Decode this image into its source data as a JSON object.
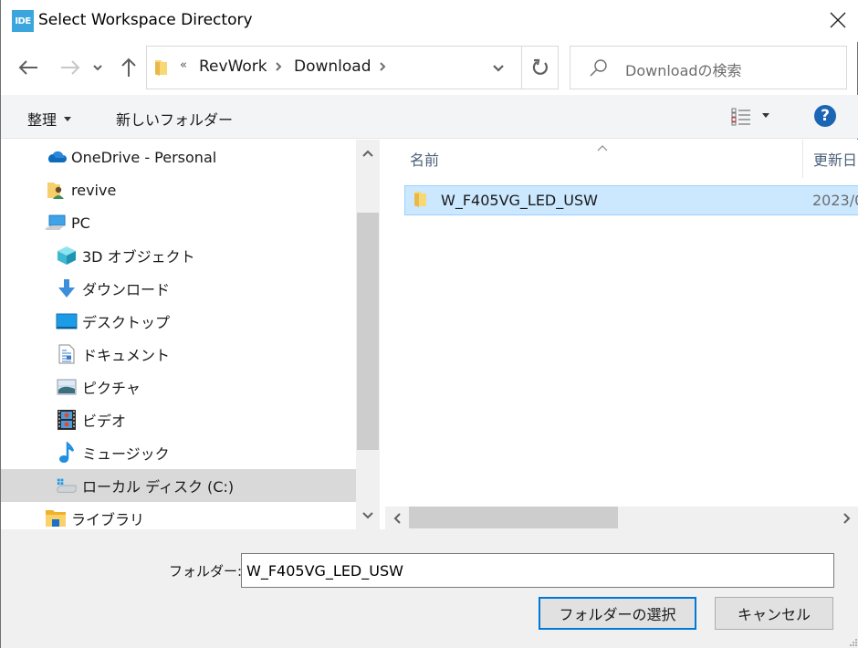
{
  "window": {
    "app_icon_text": "IDE",
    "title": "Select Workspace Directory"
  },
  "navigation": {
    "back": "back",
    "forward": "forward",
    "recent": "recent-locations",
    "up": "up"
  },
  "address": {
    "overflow_glyph": "«",
    "breadcrumbs": [
      "RevWork",
      "Download"
    ],
    "separator": "›"
  },
  "search": {
    "placeholder": "Downloadの検索"
  },
  "commands": {
    "organize": "整理",
    "new_folder": "新しいフォルダー"
  },
  "nav_pane": {
    "items": [
      {
        "label": "OneDrive - Personal",
        "icon": "onedrive-cloud-icon",
        "level": 1
      },
      {
        "label": "revive",
        "icon": "user-folder-icon",
        "level": 1
      },
      {
        "label": "PC",
        "icon": "pc-icon",
        "level": 1
      },
      {
        "label": "3D オブジェクト",
        "icon": "3d-objects-icon",
        "level": 2
      },
      {
        "label": "ダウンロード",
        "icon": "download-arrow-icon",
        "level": 2
      },
      {
        "label": "デスクトップ",
        "icon": "desktop-icon",
        "level": 2
      },
      {
        "label": "ドキュメント",
        "icon": "documents-icon",
        "level": 2
      },
      {
        "label": "ピクチャ",
        "icon": "pictures-icon",
        "level": 2
      },
      {
        "label": "ビデオ",
        "icon": "videos-icon",
        "level": 2
      },
      {
        "label": "ミュージック",
        "icon": "music-note-icon",
        "level": 2
      },
      {
        "label": "ローカル ディスク (C:)",
        "icon": "local-disk-icon",
        "level": 2,
        "selected": true
      },
      {
        "label": "ライブラリ",
        "icon": "libraries-icon",
        "level": 1
      }
    ]
  },
  "content": {
    "columns": {
      "name": "名前",
      "modified": "更新日"
    },
    "files": [
      {
        "name": "W_F405VG_LED_USW",
        "date": "2023/0",
        "type": "folder",
        "selected": true
      }
    ]
  },
  "footer": {
    "folder_label": "フォルダー:",
    "folder_value": "W_F405VG_LED_USW",
    "select_button": "フォルダーの選択",
    "cancel_button": "キャンセル"
  },
  "colors": {
    "accent": "#0078d7",
    "selection_bg": "#cce8ff",
    "selection_border": "#99d1ff",
    "help_blue": "#1a65b4",
    "app_icon": "#3aa6dd"
  }
}
